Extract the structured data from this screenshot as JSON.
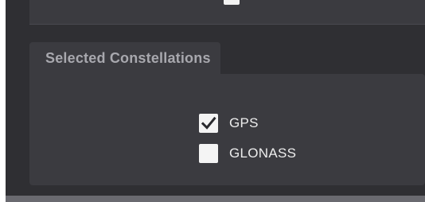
{
  "group": {
    "title": "Selected Constellations"
  },
  "constellations": [
    {
      "label": "GPS",
      "checked": true
    },
    {
      "label": "GLONASS",
      "checked": false
    }
  ],
  "colors": {
    "background": "#2f2f33",
    "panel": "#3b3b40",
    "title_text": "#a8a8ae",
    "label_text": "#ededed",
    "checkbox": "#f4f4f4",
    "check_mark": "#2a2a2e"
  }
}
